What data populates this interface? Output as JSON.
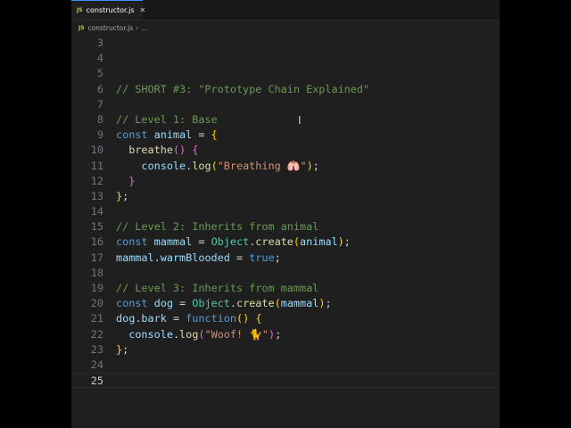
{
  "tab": {
    "icon": "js-file-icon",
    "label": "constructor.js"
  },
  "breadcrumb": {
    "file": "constructor.js",
    "more": "..."
  },
  "colors": {
    "keyword": "#569cd6",
    "variable": "#9cdcfe",
    "function": "#dcdcaa",
    "string": "#ce9178",
    "comment": "#6a9955"
  },
  "active_line": 25,
  "lines": [
    {
      "n": "3",
      "t": []
    },
    {
      "n": "4",
      "t": []
    },
    {
      "n": "5",
      "t": []
    },
    {
      "n": "6",
      "t": [
        [
          "// SHORT #3: \"Prototype Chain Explained\"",
          "cm"
        ]
      ]
    },
    {
      "n": "7",
      "t": []
    },
    {
      "n": "8",
      "t": [
        [
          "// Level 1: Base",
          "cm"
        ]
      ]
    },
    {
      "n": "9",
      "t": [
        [
          "const",
          "kw"
        ],
        [
          " ",
          "pl"
        ],
        [
          "animal",
          "var"
        ],
        [
          " = ",
          "pl"
        ],
        [
          "{",
          "b1"
        ]
      ]
    },
    {
      "n": "10",
      "t": [
        [
          "  ",
          "pl"
        ],
        [
          "breathe",
          "fn"
        ],
        [
          "()",
          "b2"
        ],
        [
          " ",
          "pl"
        ],
        [
          "{",
          "b2"
        ]
      ]
    },
    {
      "n": "11",
      "t": [
        [
          "    ",
          "pl"
        ],
        [
          "console",
          "var"
        ],
        [
          ".",
          "pl"
        ],
        [
          "log",
          "fn"
        ],
        [
          "(",
          "b1"
        ],
        [
          "\"Breathing 🫁\"",
          "str"
        ],
        [
          ")",
          "b1"
        ],
        [
          ";",
          "pl"
        ]
      ]
    },
    {
      "n": "12",
      "t": [
        [
          "  ",
          "pl"
        ],
        [
          "}",
          "b2"
        ]
      ]
    },
    {
      "n": "13",
      "t": [
        [
          "}",
          "b1"
        ],
        [
          ";",
          "pl"
        ]
      ]
    },
    {
      "n": "14",
      "t": []
    },
    {
      "n": "15",
      "t": [
        [
          "// Level 2: Inherits from animal",
          "cm"
        ]
      ]
    },
    {
      "n": "16",
      "t": [
        [
          "const",
          "kw"
        ],
        [
          " ",
          "pl"
        ],
        [
          "mammal",
          "var"
        ],
        [
          " = ",
          "pl"
        ],
        [
          "Object",
          "cls"
        ],
        [
          ".",
          "pl"
        ],
        [
          "create",
          "fn"
        ],
        [
          "(",
          "b1"
        ],
        [
          "animal",
          "var"
        ],
        [
          ")",
          "b1"
        ],
        [
          ";",
          "pl"
        ]
      ]
    },
    {
      "n": "17",
      "t": [
        [
          "mammal",
          "var"
        ],
        [
          ".",
          "pl"
        ],
        [
          "warmBlooded",
          "var"
        ],
        [
          " = ",
          "pl"
        ],
        [
          "true",
          "kw"
        ],
        [
          ";",
          "pl"
        ]
      ]
    },
    {
      "n": "18",
      "t": []
    },
    {
      "n": "19",
      "t": [
        [
          "// Level 3: Inherits from mammal",
          "cm"
        ]
      ]
    },
    {
      "n": "20",
      "t": [
        [
          "const",
          "kw"
        ],
        [
          " ",
          "pl"
        ],
        [
          "dog",
          "var"
        ],
        [
          " = ",
          "pl"
        ],
        [
          "Object",
          "cls"
        ],
        [
          ".",
          "pl"
        ],
        [
          "create",
          "fn"
        ],
        [
          "(",
          "b1"
        ],
        [
          "mammal",
          "var"
        ],
        [
          ")",
          "b1"
        ],
        [
          ";",
          "pl"
        ]
      ]
    },
    {
      "n": "21",
      "t": [
        [
          "dog",
          "var"
        ],
        [
          ".",
          "pl"
        ],
        [
          "bark",
          "var"
        ],
        [
          " = ",
          "pl"
        ],
        [
          "function",
          "kw"
        ],
        [
          "()",
          "b1"
        ],
        [
          " ",
          "pl"
        ],
        [
          "{",
          "b1"
        ]
      ]
    },
    {
      "n": "22",
      "t": [
        [
          "  ",
          "pl"
        ],
        [
          "console",
          "var"
        ],
        [
          ".",
          "pl"
        ],
        [
          "log",
          "fn"
        ],
        [
          "(",
          "b2"
        ],
        [
          "\"Woof! 🐈\"",
          "str"
        ],
        [
          ")",
          "b2"
        ],
        [
          ";",
          "pl"
        ]
      ]
    },
    {
      "n": "23",
      "t": [
        [
          "}",
          "b1"
        ],
        [
          ";",
          "pl"
        ]
      ]
    },
    {
      "n": "24",
      "t": []
    },
    {
      "n": "25",
      "t": []
    }
  ]
}
